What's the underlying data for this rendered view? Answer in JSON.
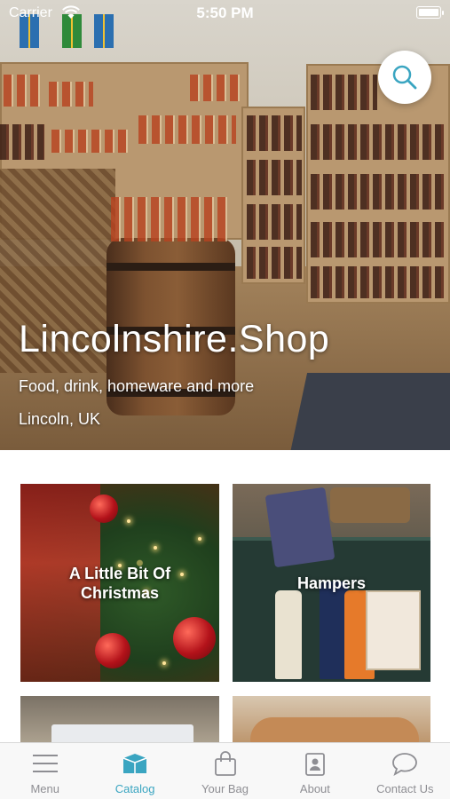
{
  "status_bar": {
    "carrier": "Carrier",
    "time": "5:50 PM"
  },
  "hero": {
    "title": "Lincolnshire.Shop",
    "subtitle": "Food, drink, homeware and more",
    "location": "Lincoln, UK"
  },
  "search": {
    "icon": "search-icon"
  },
  "categories": [
    {
      "label_line1": "A Little Bit Of",
      "label_line2": "Christmas"
    },
    {
      "label_line1": "Hampers",
      "label_line2": ""
    }
  ],
  "tabbar": {
    "accent_color": "#3aa5c1",
    "inactive_color": "#8e8e93",
    "items": [
      {
        "label": "Menu",
        "icon": "menu-icon"
      },
      {
        "label": "Catalog",
        "icon": "catalog-icon",
        "active": true
      },
      {
        "label": "Your Bag",
        "icon": "bag-icon"
      },
      {
        "label": "About",
        "icon": "about-icon"
      },
      {
        "label": "Contact Us",
        "icon": "chat-icon"
      }
    ]
  }
}
